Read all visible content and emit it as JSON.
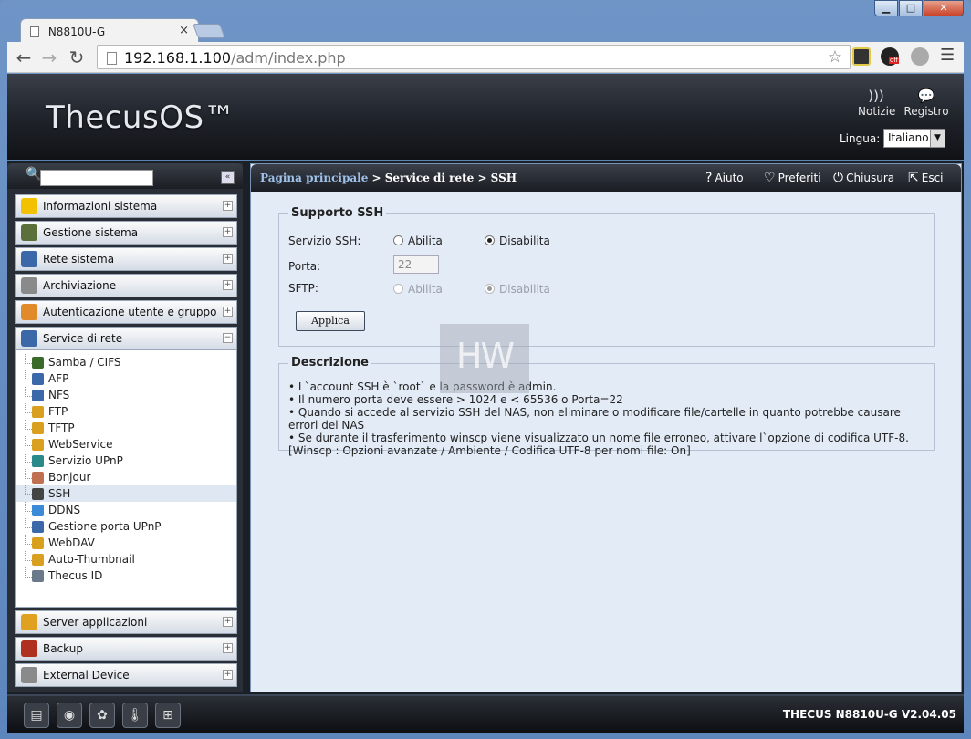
{
  "browser": {
    "tab_title": "N8810U-G",
    "tab_close": "×",
    "url_host": "192.168.1.100",
    "url_path": "/adm/index.php",
    "window_controls": {
      "minimize": "▁",
      "maximize": "□",
      "close": "✕"
    },
    "ext_badge": "off"
  },
  "header": {
    "logo": "ThecusOS™",
    "links": [
      {
        "label": "Notizie",
        "icon": "rss-icon"
      },
      {
        "label": "Registro",
        "icon": "chat-icon"
      }
    ],
    "language_label": "Lingua:",
    "language_value": "Italiano"
  },
  "sidebar": {
    "search_placeholder": "",
    "collapse_label": "«",
    "categories_top": [
      {
        "label": "Informazioni sistema",
        "icon": "info-icon",
        "color": "#f2c200"
      },
      {
        "label": "Gestione sistema",
        "icon": "tools-icon",
        "color": "#5a6f3a"
      },
      {
        "label": "Rete sistema",
        "icon": "network-icon",
        "color": "#3a68a8"
      },
      {
        "label": "Archiviazione",
        "icon": "storage-icon",
        "color": "#8a8a8a"
      },
      {
        "label": "Autenticazione utente e gruppo",
        "icon": "users-icon",
        "color": "#e08a2a"
      },
      {
        "label": "Service di rete",
        "icon": "network-service-icon",
        "color": "#3a68a8",
        "expanded": true
      }
    ],
    "sub_items": [
      {
        "label": "Samba / CIFS",
        "color": "#3a6a2a"
      },
      {
        "label": "AFP",
        "color": "#3a68a8"
      },
      {
        "label": "NFS",
        "color": "#3a68a8"
      },
      {
        "label": "FTP",
        "color": "#d9a020"
      },
      {
        "label": "TFTP",
        "color": "#d9a020"
      },
      {
        "label": "WebService",
        "color": "#d9a020"
      },
      {
        "label": "Servizio UPnP",
        "color": "#2a8a8a"
      },
      {
        "label": "Bonjour",
        "color": "#c07050"
      },
      {
        "label": "SSH",
        "color": "#444444",
        "active": true
      },
      {
        "label": "DDNS",
        "color": "#3a8ad8"
      },
      {
        "label": "Gestione porta UPnP",
        "color": "#3a68a8"
      },
      {
        "label": "WebDAV",
        "color": "#d9a020"
      },
      {
        "label": "Auto-Thumbnail",
        "color": "#d9a020"
      },
      {
        "label": "Thecus ID",
        "color": "#6a7a8a"
      }
    ],
    "categories_bottom": [
      {
        "label": "Server applicazioni",
        "icon": "app-server-icon",
        "color": "#e0a020"
      },
      {
        "label": "Backup",
        "icon": "backup-icon",
        "color": "#b03020"
      },
      {
        "label": "External Device",
        "icon": "external-device-icon",
        "color": "#8a8a8a"
      }
    ],
    "plus": "+",
    "minus": "−"
  },
  "breadcrumb": {
    "home": "Pagina principale",
    "path": " > Service di rete > SSH",
    "actions": [
      {
        "label": "Aiuto",
        "icon": "help-icon",
        "glyph": "?"
      },
      {
        "label": "Preferiti",
        "icon": "heart-icon",
        "glyph": "♡"
      },
      {
        "label": "Chiusura",
        "icon": "power-icon",
        "glyph": "⏻"
      },
      {
        "label": "Esci",
        "icon": "exit-icon",
        "glyph": "⇱"
      }
    ]
  },
  "ssh_support": {
    "legend": "Supporto SSH",
    "ssh_service_label": "Servizio SSH:",
    "enable": "Abilita",
    "disable": "Disabilita",
    "ssh_service_value": "Disabilita",
    "port_label": "Porta:",
    "port_value": "22",
    "sftp_label": "SFTP:",
    "sftp_value": "Disabilita",
    "apply": "Applica"
  },
  "description": {
    "legend": "Descrizione",
    "lines": [
      "• L`account SSH è `root` e la password è admin.",
      "• Il numero porta deve essere > 1024 e < 65536 o Porta=22",
      "• Quando si accede al servizio SSH del NAS, non eliminare o modificare file/cartelle in quanto potrebbe causare errori del NAS",
      "• Se durante il trasferimento winscp viene visualizzato un nome file erroneo, attivare l`opzione di codifica UTF-8. [Winscp : Opzioni avanzate / Ambiente / Codifica UTF-8 per nomi file: On]"
    ]
  },
  "watermark": "HW",
  "footer": {
    "icons": [
      "disk-array-icon",
      "hdd-icon",
      "fan-icon",
      "temperature-icon",
      "network-tree-icon"
    ],
    "version": "THECUS N8810U-G V2.04.05"
  }
}
